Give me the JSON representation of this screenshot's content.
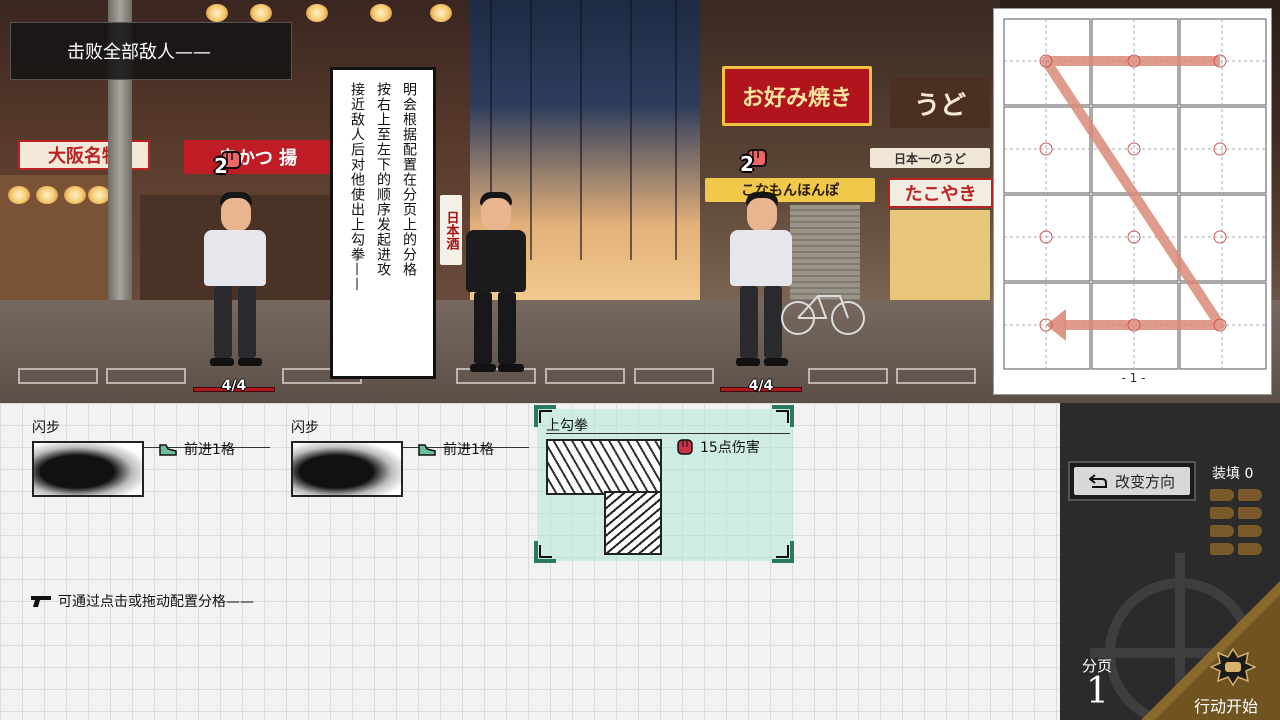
{
  "objective": "击败全部敌人——",
  "tutorial_bubble": {
    "lines": [
      "明会根据配置在分页上的分格",
      "按右上至左下的顺序发起进攻",
      "接近敌人后对他使出上勾拳——"
    ]
  },
  "signs": {
    "osaka": "大阪名物",
    "okonomiyaki": "お好み焼き",
    "udon": "うど",
    "takoyaki": "たこやき",
    "konamon": "こなもんほんぽ",
    "nippon_ichi": "日本一のうど",
    "kushikatsu": "串かつ 揚",
    "vertical_left": "日本酒"
  },
  "enemies": [
    {
      "id": "left",
      "attack": "2",
      "hp": "4/4"
    },
    {
      "id": "right",
      "attack": "2",
      "hp": "4/4"
    }
  ],
  "mini_map": {
    "page_label": "- 1 -"
  },
  "cards": [
    {
      "title": "闪步",
      "effect": "前进1格",
      "effect_icon": "shoe-icon"
    },
    {
      "title": "闪步",
      "effect": "前进1格",
      "effect_icon": "shoe-icon"
    },
    {
      "title": "上勾拳",
      "effect": "15点伤害",
      "effect_icon": "fist-icon",
      "selected": true
    }
  ],
  "hint": "可通过点击或拖动配置分格——",
  "side_panel": {
    "change_direction": "改变方向",
    "load_label": "装填 0",
    "page_label": "分页",
    "page_number": "1",
    "start_action": "行动开始"
  },
  "colors": {
    "selected_card_bg": "#b0e8d6",
    "hp_bar": "#b3151d",
    "path_arrow": "#d98a78"
  }
}
